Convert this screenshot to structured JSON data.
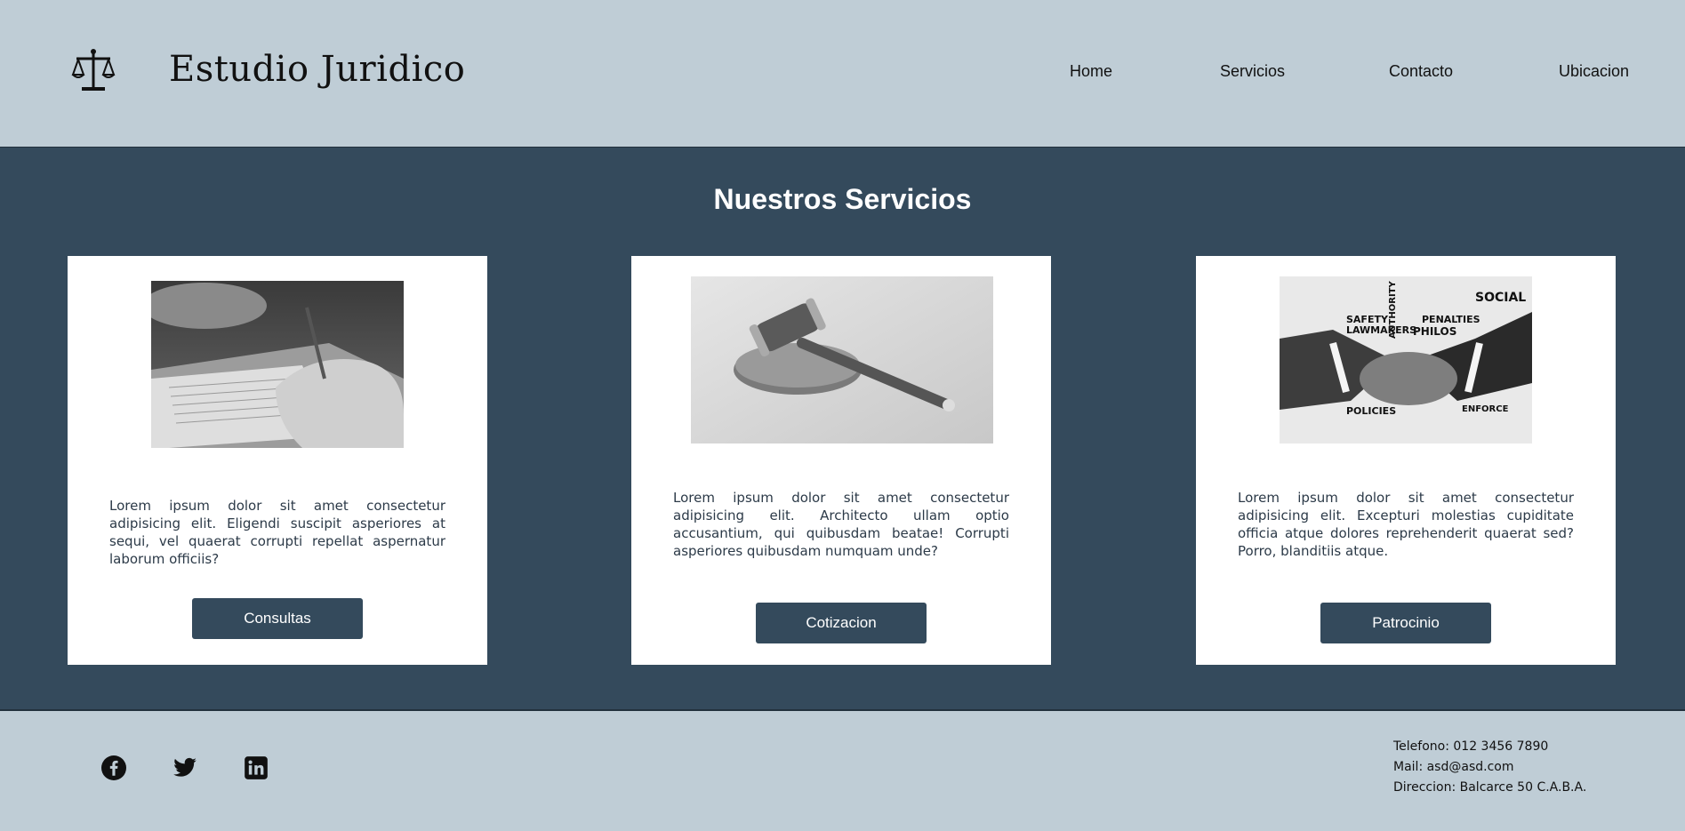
{
  "header": {
    "brand": "Estudio Juridico",
    "logo_icon": "scales-of-justice-icon",
    "nav": [
      "Home",
      "Servicios",
      "Contacto",
      "Ubicacion"
    ]
  },
  "services": {
    "title": "Nuestros Servicios",
    "cards": [
      {
        "image": "signing-document-photo",
        "text": "Lorem ipsum dolor sit amet consectetur adipisicing elit. Eligendi suscipit asperiores at sequi, vel quaerat corrupti repellat aspernatur laborum officiis?",
        "button": "Consultas"
      },
      {
        "image": "gavel-photo",
        "text": "Lorem ipsum dolor sit amet consectetur adipisicing elit. Architecto ullam optio accusantium, qui quibusdam beatae! Corrupti asperiores quibusdam numquam unde?",
        "button": "Cotizacion"
      },
      {
        "image": "handshake-law-words-photo",
        "text": "Lorem ipsum dolor sit amet consectetur adipisicing elit. Excepturi molestias cupiditate officia atque dolores reprehenderit quaerat sed? Porro, blanditiis atque.",
        "button": "Patrocinio"
      }
    ]
  },
  "footer": {
    "social_icons": [
      "facebook-icon",
      "twitter-icon",
      "linkedin-icon"
    ],
    "contact": [
      "Telefono: 012 3456 7890",
      "Mail: asd@asd.com",
      "Direccion: Balcarce 50 C.A.B.A."
    ]
  },
  "colors": {
    "header_bg": "#bfcdd6",
    "section_bg": "#344a5c",
    "button_bg": "#344a5c",
    "card_bg": "#ffffff"
  }
}
